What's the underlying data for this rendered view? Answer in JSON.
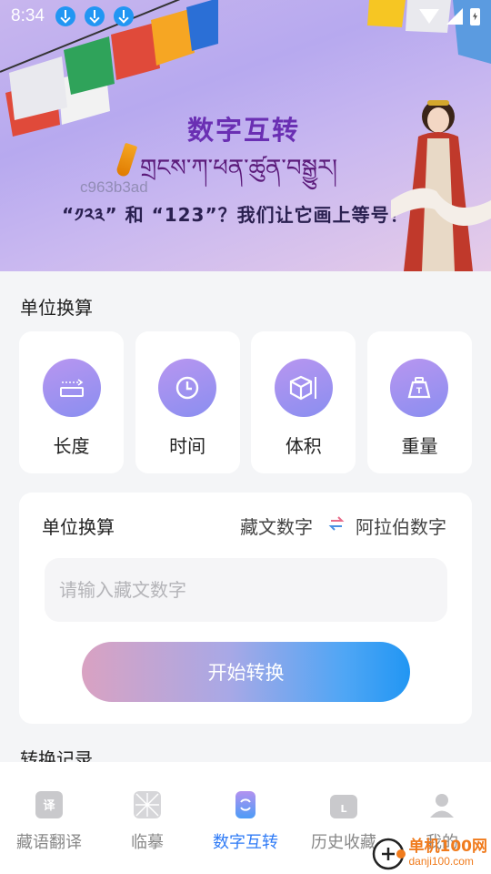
{
  "status_bar": {
    "time": "8:34"
  },
  "banner": {
    "title": "数字互转",
    "tibetan": "གྲངས་ཀ་ཕན་ཚུན་བསྒྱུར།",
    "watermark": "c963b3ad",
    "subtitle": "“༡༢༣” 和 “123”？我们让它画上等号！"
  },
  "unit_section": {
    "title": "单位换算",
    "items": [
      {
        "label": "长度",
        "icon": "ruler-icon"
      },
      {
        "label": "时间",
        "icon": "clock-icon"
      },
      {
        "label": "体积",
        "icon": "cube-icon"
      },
      {
        "label": "重量",
        "icon": "weight-icon"
      }
    ]
  },
  "converter": {
    "title": "单位换算",
    "from": "藏文数字",
    "to": "阿拉伯数字",
    "input_placeholder": "请输入藏文数字",
    "input_value": "",
    "button": "开始转换"
  },
  "history": {
    "title": "转换记录"
  },
  "bottom_nav": [
    {
      "label": "藏语翻译",
      "icon": "translate-icon",
      "active": false
    },
    {
      "label": "临摹",
      "icon": "grid-icon",
      "active": false
    },
    {
      "label": "数字互转",
      "icon": "convert-icon",
      "active": true
    },
    {
      "label": "历史收藏",
      "icon": "folder-icon",
      "active": false
    },
    {
      "label": "我的",
      "icon": "user-icon",
      "active": false
    }
  ],
  "brand": {
    "name": "单机100网",
    "url": "danji100.com"
  },
  "colors": {
    "accent": "#2f7bf6",
    "icon_gradient_start": "#b896f0",
    "icon_gradient_end": "#8a8ef0",
    "button_end": "#2196f3"
  }
}
